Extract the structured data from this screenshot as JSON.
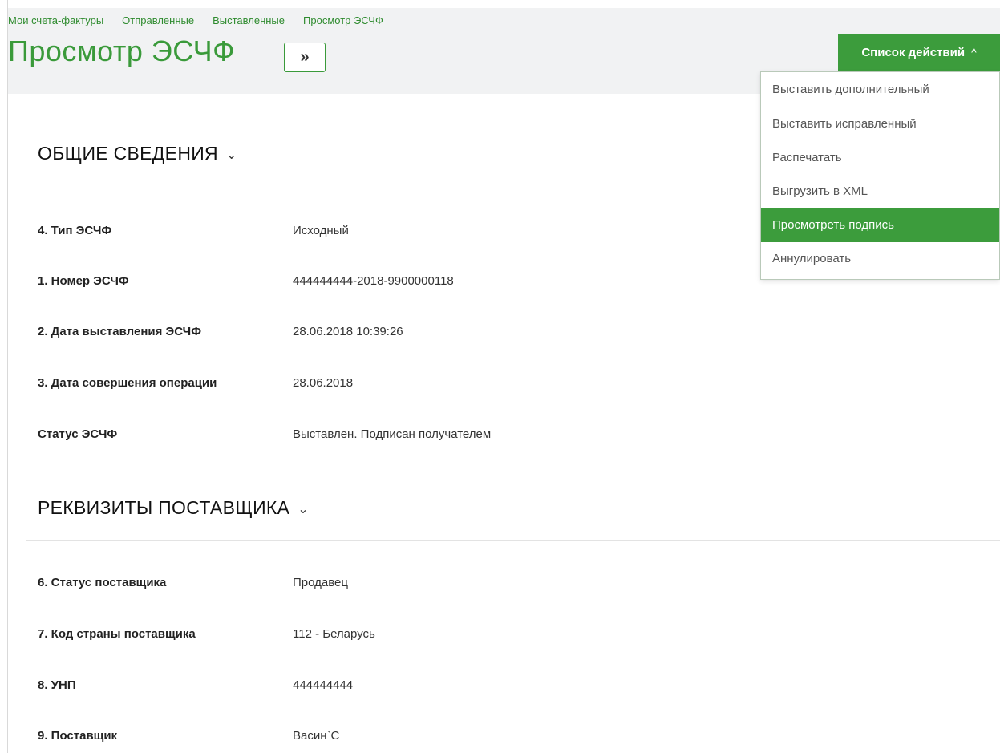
{
  "breadcrumb": [
    "Мои счета-фактуры",
    "Отправленные",
    "Выставленные",
    "Просмотр ЭСЧФ"
  ],
  "page_title": "Просмотр ЭСЧФ",
  "expand_button": "»",
  "actions": {
    "label": "Список действий",
    "caret": "^",
    "items": [
      "Выставить дополнительный",
      "Выставить исправленный",
      "Распечатать",
      "Выгрузить в XML",
      "Просмотреть подпись",
      "Аннулировать"
    ],
    "active_item": "Просмотреть подпись"
  },
  "sections": [
    {
      "title": "ОБЩИЕ СВЕДЕНИЯ",
      "rows": [
        {
          "label": "4. Тип ЭСЧФ",
          "value": "Исходный"
        },
        {
          "label": "1. Номер ЭСЧФ",
          "value": "444444444-2018-9900000118"
        },
        {
          "label": "2. Дата выставления ЭСЧФ",
          "value": "28.06.2018 10:39:26"
        },
        {
          "label": "3. Дата совершения операции",
          "value": "28.06.2018"
        },
        {
          "label": "Статус ЭСЧФ",
          "value": "Выставлен. Подписан получателем"
        }
      ]
    },
    {
      "title": "РЕКВИЗИТЫ ПОСТАВЩИКА",
      "rows": [
        {
          "label": "6. Статус поставщика",
          "value": "Продавец"
        },
        {
          "label": "7. Код страны поставщика",
          "value": "112 - Беларусь"
        },
        {
          "label": "8. УНП",
          "value": "444444444"
        },
        {
          "label": "9. Поставщик",
          "value": "Васин`С"
        }
      ]
    }
  ],
  "colors": {
    "accent": "#3c9c3c",
    "link": "#2e8b2e",
    "header_bg": "#f1f2f3"
  }
}
